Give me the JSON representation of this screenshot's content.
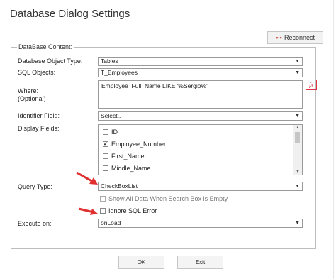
{
  "dialog": {
    "title": "Database Dialog Settings"
  },
  "toolbar": {
    "reconnect_label": "Reconnect",
    "reconnect_icon": "plug-icon"
  },
  "section": {
    "legend": "DataBase Content:"
  },
  "fields": {
    "object_type": {
      "label": "Database Object Type:",
      "value": "Tables"
    },
    "sql_objects": {
      "label": "SQL Objects:",
      "value": "T_Employees"
    },
    "where": {
      "label": "Where:",
      "sublabel": "(Optional)",
      "value": "Employee_Full_Name LIKE '%Sergio%'",
      "fx_label": "fx"
    },
    "identifier": {
      "label": "Identifier Field:",
      "value": "Select.."
    },
    "display": {
      "label": "Display Fields:",
      "items": [
        {
          "label": "ID",
          "checked": false
        },
        {
          "label": "Employee_Number",
          "checked": true
        },
        {
          "label": "First_Name",
          "checked": false
        },
        {
          "label": "Middle_Name",
          "checked": false
        }
      ]
    },
    "query_type": {
      "label": "Query Type:",
      "value": "CheckBoxList"
    },
    "show_all": {
      "label": "Show All Data When Search Box is Empty"
    },
    "ignore_sql": {
      "label": "Ignore SQL Error"
    },
    "execute_on": {
      "label": "Execute on:",
      "value": "onLoad"
    }
  },
  "buttons": {
    "ok": "OK",
    "exit": "Exit"
  },
  "colors": {
    "arrow": "#e03030",
    "fx": "#dd3344"
  }
}
